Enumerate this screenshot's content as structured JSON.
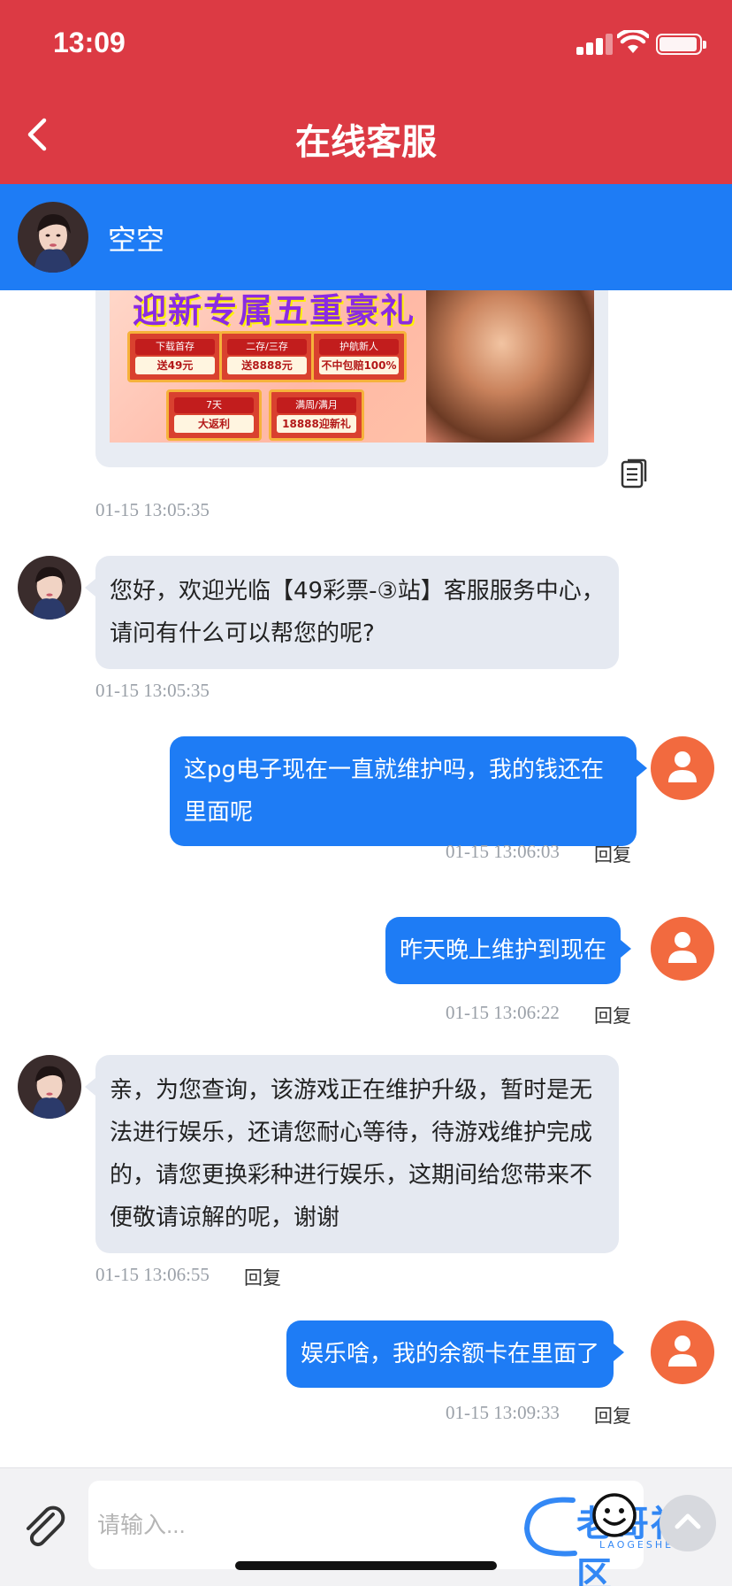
{
  "status": {
    "time": "13:09"
  },
  "nav": {
    "title": "在线客服"
  },
  "agent": {
    "name": "空空"
  },
  "promo": {
    "headline": "迎新专属五重豪礼",
    "gifts": [
      {
        "top": "下载首存",
        "bottom": "送49元"
      },
      {
        "top": "二存/三存",
        "bottom": "送8888元"
      },
      {
        "top": "护航新人",
        "bottom": "不中包赔100%"
      },
      {
        "top": "7天",
        "bottom": "大返利"
      },
      {
        "top": "满周/满月",
        "bottom": "18888迎新礼"
      }
    ],
    "timestamp": "01-15 13:05:35"
  },
  "messages": [
    {
      "from": "agent",
      "text": "您好，欢迎光临【49彩票-③站】客服服务中心，请问有什么可以帮您的呢?",
      "time": "01-15 13:05:35"
    },
    {
      "from": "user",
      "text": "这pg电子现在一直就维护吗，我的钱还在里面呢",
      "time": "01-15 13:06:03",
      "reply": "回复"
    },
    {
      "from": "user",
      "text": "昨天晚上维护到现在",
      "time": "01-15 13:06:22",
      "reply": "回复"
    },
    {
      "from": "agent",
      "text": "亲，为您查询，该游戏正在维护升级，暂时是无法进行娱乐，还请您耐心等待，待游戏维护完成的，请您更换彩种进行娱乐，这期间给您带来不便敬请谅解的呢，谢谢",
      "time": "01-15 13:06:55",
      "reply": "回复"
    },
    {
      "from": "user",
      "text": "娱乐啥，我的余额卡在里面了",
      "time": "01-15 13:09:33",
      "reply": "回复"
    }
  ],
  "input": {
    "placeholder": "请输入..."
  },
  "watermark": {
    "text": "老哥社区",
    "sub": "LAOGESHEQU"
  },
  "colors": {
    "header": "#dc3a44",
    "agent_bar": "#1e7cf5",
    "user_bubble": "#1e7cf5",
    "agent_bubble": "#e5e9f1",
    "user_avatar": "#f26a3f"
  }
}
